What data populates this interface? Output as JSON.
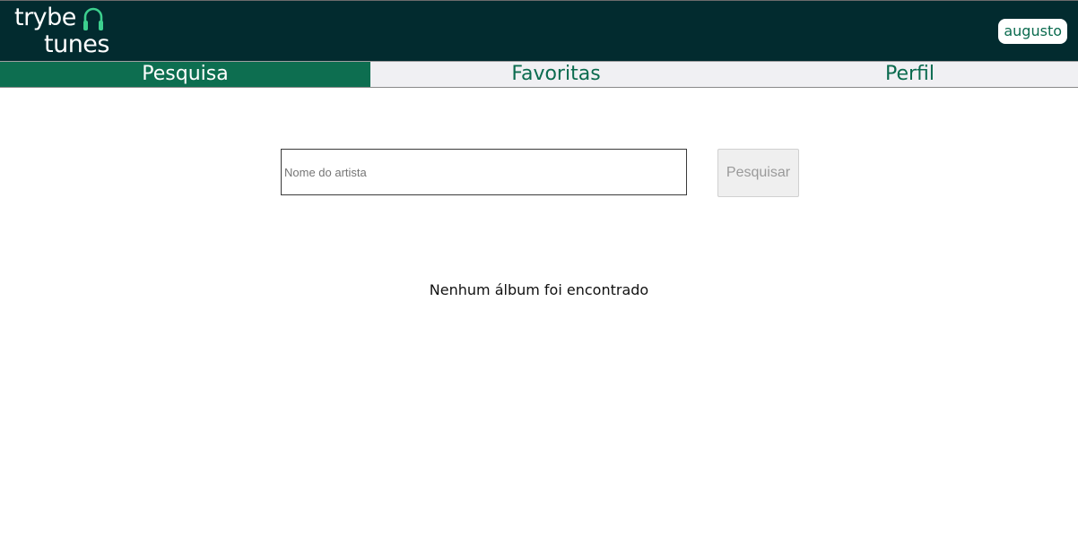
{
  "header": {
    "logo": {
      "line1": "trybe",
      "line2": "tunes",
      "icon": "headphones-icon",
      "icon_color": "#3ccf8e"
    },
    "user_name": "augusto"
  },
  "nav": {
    "items": [
      {
        "label": "Pesquisa",
        "active": true
      },
      {
        "label": "Favoritas",
        "active": false
      },
      {
        "label": "Perfil",
        "active": false
      }
    ]
  },
  "search": {
    "placeholder": "Nome do artista",
    "value": "",
    "button_label": "Pesquisar",
    "button_disabled": true
  },
  "results": {
    "empty_message": "Nenhum álbum foi encontrado"
  },
  "colors": {
    "header_bg": "#022b2f",
    "accent": "#0d6e50",
    "nav_bg": "#f0f0f3"
  }
}
